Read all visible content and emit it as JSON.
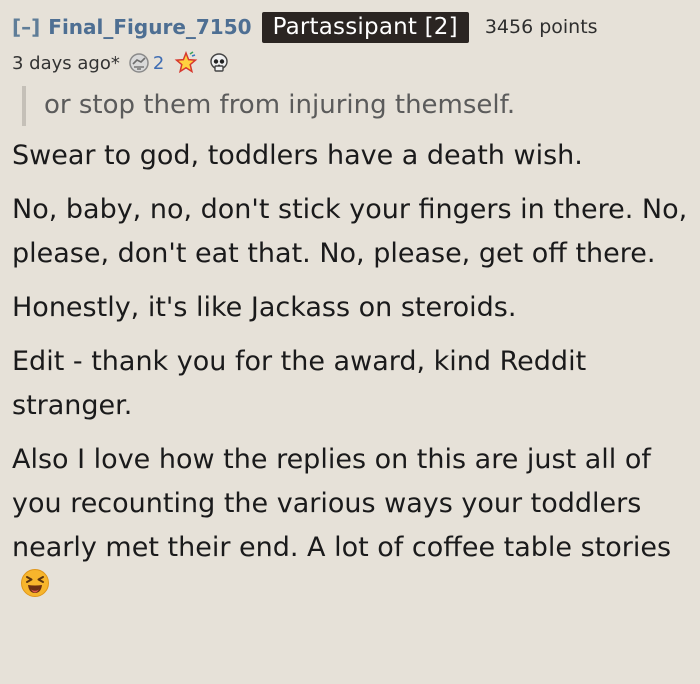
{
  "comment": {
    "collapse_label": "[–]",
    "author": "Final_Figure_7150",
    "flair": "Partassipant [2]",
    "score": "3456 points",
    "time": "3 days ago*",
    "awards": [
      {
        "icon": "silver-award-icon",
        "count": "2"
      },
      {
        "icon": "star-award-icon"
      },
      {
        "icon": "skull-award-icon"
      }
    ],
    "quote": "or stop them from injuring themself.",
    "paragraphs": [
      "Swear to god, toddlers have a death wish.",
      "No, baby, no, don't stick your fingers in there. No, please, don't eat that. No, please, get off there.",
      "Honestly, it's like Jackass on steroids.",
      "Edit - thank you for the award, kind Reddit stranger.",
      "Also I love how the replies on this are just all of you recounting the various ways your toddlers nearly met their end. A lot of coffee table stories"
    ],
    "emoji": "laughing-face-icon",
    "colors": {
      "background": "#e6e1d8",
      "author": "#4e6f93",
      "flair_bg": "#2b2522",
      "emoji": "#f5a623"
    }
  }
}
